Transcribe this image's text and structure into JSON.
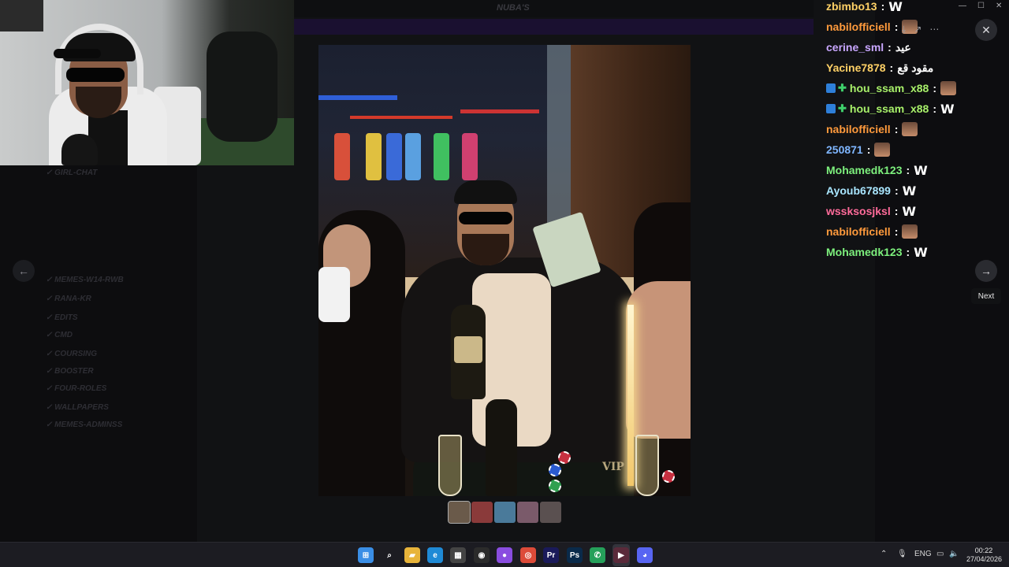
{
  "chat": {
    "messages": [
      {
        "user": "zbimbo13",
        "color": "#ffd166",
        "badges": [],
        "text": "",
        "emote": "W"
      },
      {
        "user": "nabilofficiell",
        "color": "#ff9a3c",
        "badges": [],
        "text": "",
        "emote": "face"
      },
      {
        "user": "cerine_sml",
        "color": "#c9a7ff",
        "badges": [],
        "text": "عيد",
        "emote": ""
      },
      {
        "user": "Yacine7878",
        "color": "#ffd166",
        "badges": [],
        "text": "مقود قع",
        "emote": ""
      },
      {
        "user": "hou_ssam_x88",
        "color": "#a8f06a",
        "badges": [
          "blue",
          "green"
        ],
        "text": "",
        "emote": "face"
      },
      {
        "user": "hou_ssam_x88",
        "color": "#a8f06a",
        "badges": [
          "blue",
          "green"
        ],
        "text": "",
        "emote": "W"
      },
      {
        "user": "nabilofficiell",
        "color": "#ff9a3c",
        "badges": [],
        "text": "",
        "emote": "face"
      },
      {
        "user": "250871",
        "color": "#7fb6ff",
        "badges": [],
        "text": "",
        "emote": "face"
      },
      {
        "user": "Mohamedk123",
        "color": "#7df07d",
        "badges": [],
        "text": "",
        "emote": "W"
      },
      {
        "user": "Ayoub67899",
        "color": "#a9e6ff",
        "badges": [],
        "text": "",
        "emote": "W"
      },
      {
        "user": "wssksosjksl",
        "color": "#ff6b9a",
        "badges": [],
        "text": "",
        "emote": "W"
      },
      {
        "user": "nabilofficiell",
        "color": "#ff9a3c",
        "badges": [],
        "text": "",
        "emote": "face"
      },
      {
        "user": "Mohamedk123",
        "color": "#7df07d",
        "badges": [],
        "text": "",
        "emote": "W"
      }
    ]
  },
  "viewer": {
    "next_tooltip": "Next",
    "image_sign": "VIP",
    "thumbnails": [
      "#6a5a4a",
      "#8a3a3a",
      "#4a7a9a",
      "#7a5a6a",
      "#5a5050"
    ]
  },
  "background": {
    "top_title": "NUBA'S",
    "channels": [
      "✓ GIRL-CHAT",
      "✓ MEMES-W14-RWB",
      "✓ RANA-KR",
      "✓ EDITS",
      "✓ CMD",
      "✓ COURSING",
      "✓ BOOSTER",
      "✓ FOUR-ROLES",
      "✓ WALLPAPERS",
      "✓ MEMES-ADMINSS"
    ]
  },
  "taskbar": {
    "apps": [
      {
        "name": "windows-start",
        "glyph": "⊞",
        "color": "#3a8ee6"
      },
      {
        "name": "search",
        "glyph": "⌕",
        "color": "transparent"
      },
      {
        "name": "file-explorer",
        "glyph": "▰",
        "color": "#e8b43a"
      },
      {
        "name": "edge",
        "glyph": "e",
        "color": "#1f8ad6"
      },
      {
        "name": "store",
        "glyph": "▦",
        "color": "#444"
      },
      {
        "name": "obs",
        "glyph": "◉",
        "color": "#2b2b2b"
      },
      {
        "name": "messenger",
        "glyph": "●",
        "color": "#8a4de0"
      },
      {
        "name": "chrome",
        "glyph": "◎",
        "color": "#dd4b39"
      },
      {
        "name": "premiere",
        "glyph": "Pr",
        "color": "#1a1a5a"
      },
      {
        "name": "photoshop",
        "glyph": "Ps",
        "color": "#0a2a4a"
      },
      {
        "name": "whatsapp",
        "glyph": "✆",
        "color": "#25a05a"
      },
      {
        "name": "media-player",
        "glyph": "▶",
        "color": "#5a2a3a"
      },
      {
        "name": "discord",
        "glyph": "◕",
        "color": "#5865f2"
      }
    ],
    "tray": {
      "language": "ENG",
      "time": "00:22",
      "date": "27/04/2026"
    }
  },
  "colors": {
    "accent": "#5865f2",
    "chat_separator": "#ffffff"
  }
}
